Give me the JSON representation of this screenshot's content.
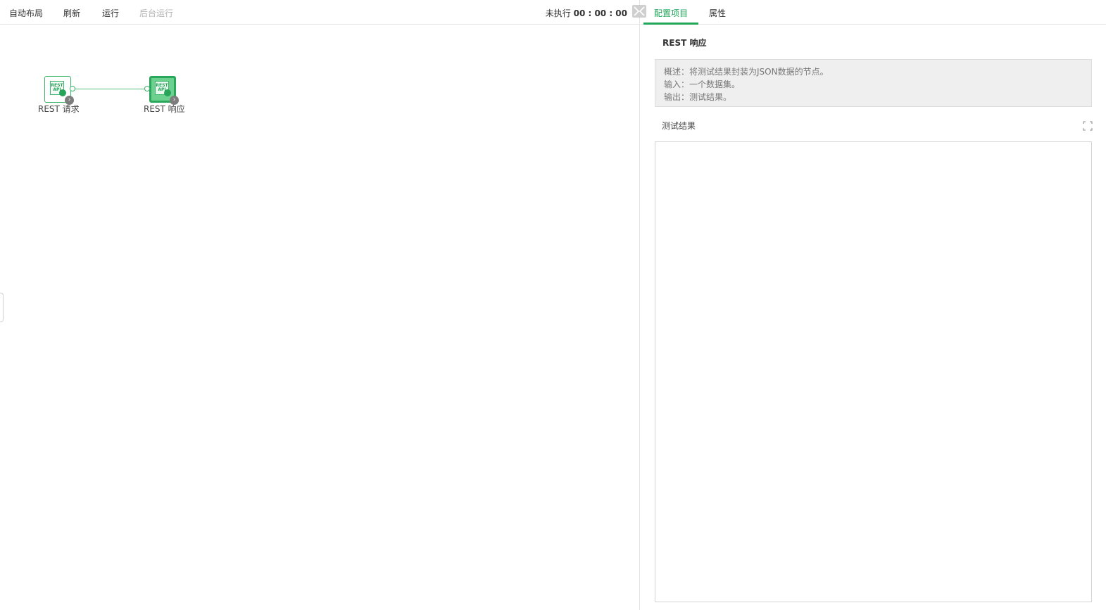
{
  "toolbar": {
    "auto_layout": "自动布局",
    "refresh": "刷新",
    "run": "运行",
    "background_run": "后台运行",
    "status_label": "未执行",
    "status_time": "00 : 00 : 00"
  },
  "canvas": {
    "nodes": [
      {
        "icon_text_top": "REST",
        "icon_text_bottom": "API",
        "label": "REST 请求",
        "selected": false
      },
      {
        "icon_text_top": "REST",
        "icon_text_bottom": "API",
        "label": "REST 响应",
        "selected": true
      }
    ]
  },
  "panel": {
    "tabs": [
      {
        "label": "配置项目",
        "active": true
      },
      {
        "label": "属性",
        "active": false
      }
    ],
    "node_title": "REST 响应",
    "description": {
      "overview": "概述：将测试结果封装为JSON数据的节点。",
      "input": "输入：一个数据集。",
      "output": "输出：测试结果。"
    },
    "result_label": "测试结果",
    "result_content": ""
  },
  "colors": {
    "accent": "#23a55a",
    "node_border": "#3bb56a",
    "disabled_text": "#b5b5b5"
  }
}
